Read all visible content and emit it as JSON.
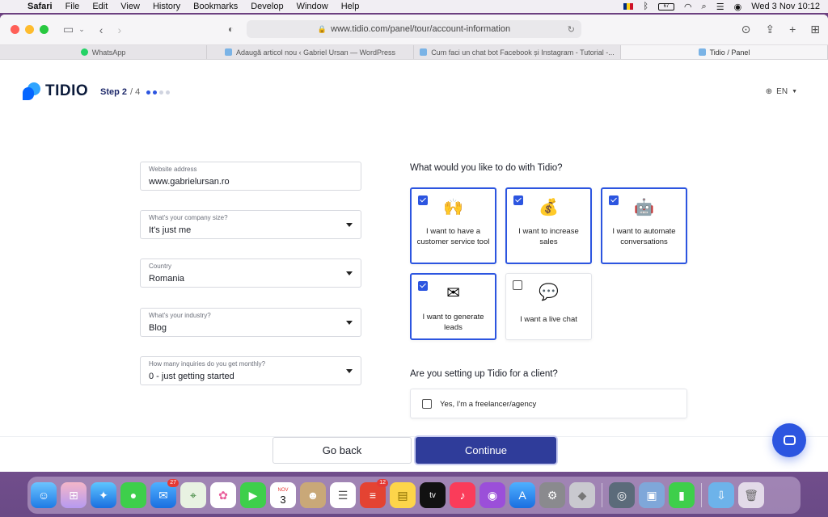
{
  "menubar": {
    "app": "Safari",
    "items": [
      "File",
      "Edit",
      "View",
      "History",
      "Bookmarks",
      "Develop",
      "Window",
      "Help"
    ],
    "battery": "67",
    "datetime": "Wed 3 Nov  10:12"
  },
  "browser": {
    "url": "www.tidio.com/panel/tour/account-information",
    "tabs": [
      {
        "label": "WhatsApp",
        "color": "#25d366"
      },
      {
        "label": "Adaugă articol nou ‹ Gabriel Ursan — WordPress",
        "color": "#7ab3e6"
      },
      {
        "label": "Cum faci un chat bot Facebook și Instagram - Tutorial -...",
        "color": "#7ab3e6"
      },
      {
        "label": "Tidio / Panel",
        "color": "#7ab3e6"
      }
    ]
  },
  "header": {
    "logo": "TIDIO",
    "step_label": "Step 2",
    "step_total": "/ 4",
    "lang": "EN"
  },
  "form": {
    "website": {
      "label": "Website address",
      "value": "www.gabrielursan.ro"
    },
    "company_size": {
      "label": "What's your company size?",
      "value": "It's just me"
    },
    "country": {
      "label": "Country",
      "value": "Romania"
    },
    "industry": {
      "label": "What's your industry?",
      "value": "Blog"
    },
    "inquiries": {
      "label": "How many inquiries do you get monthly?",
      "value": "0 - just getting started"
    }
  },
  "goals": {
    "question": "What would you like to do with Tidio?",
    "options": [
      {
        "label": "I want to have a customer service tool",
        "icon": "raised-hands-icon",
        "checked": true
      },
      {
        "label": "I want to increase sales",
        "icon": "money-bag-icon",
        "checked": true
      },
      {
        "label": "I want to automate conversations",
        "icon": "robot-icon",
        "checked": true
      },
      {
        "label": "I want to generate leads",
        "icon": "envelope-icon",
        "checked": true
      },
      {
        "label": "I want a live chat",
        "icon": "speech-bubble-icon",
        "checked": false
      }
    ]
  },
  "client": {
    "question": "Are you setting up Tidio for a client?",
    "option": "Yes, I'm a freelancer/agency"
  },
  "actions": {
    "back": "Go back",
    "continue": "Continue"
  },
  "dock": {
    "mail_badge": "27",
    "calendar_month": "NOV",
    "calendar_day": "3",
    "todoist_badge": "12",
    "tv_label": "tv"
  },
  "colors": {
    "accent": "#2c55e0",
    "primary_button": "#2f3c9a",
    "logo_blue": "#0566ff"
  }
}
